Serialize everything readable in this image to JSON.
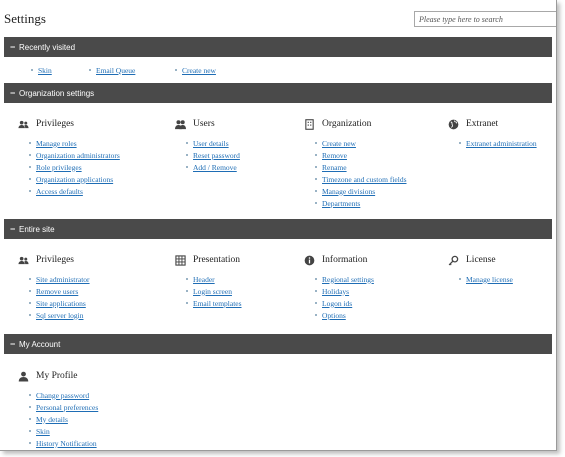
{
  "page": {
    "title": "Settings",
    "search_placeholder": "Please type here to search"
  },
  "sections": {
    "recently_visited": {
      "toggle": "−",
      "title": "Recently visited",
      "links": [
        "Skin",
        "Email Queue",
        "Create new"
      ]
    },
    "organization_settings": {
      "toggle": "−",
      "title": "Organization settings",
      "columns": [
        {
          "title": "Privileges",
          "icon": "users-icon",
          "links": [
            "Manage roles",
            "Organization administrators",
            "Role privileges",
            "Organization applications",
            "Access defaults"
          ]
        },
        {
          "title": "Users",
          "icon": "user-pair-icon",
          "links": [
            "User details",
            "Reset password",
            "Add / Remove"
          ]
        },
        {
          "title": "Organization",
          "icon": "building-icon",
          "links": [
            "Create new",
            "Remove",
            "Rename",
            "Timezone and custom fields",
            "Manage divisions",
            "Departments"
          ]
        },
        {
          "title": "Extranet",
          "icon": "globe-icon",
          "links": [
            "Extranet administration"
          ]
        }
      ]
    },
    "entire_site": {
      "toggle": "−",
      "title": "Entire site",
      "columns": [
        {
          "title": "Privileges",
          "icon": "users-icon",
          "links": [
            "Site administrator",
            "Remove users",
            "Site applications",
            "Sql server login"
          ]
        },
        {
          "title": "Presentation",
          "icon": "grid-icon",
          "links": [
            "Header",
            "Login screen",
            "Email templates"
          ]
        },
        {
          "title": "Information",
          "icon": "info-icon",
          "links": [
            "Regional settings",
            "Holidays",
            "Logon ids",
            "Options"
          ]
        },
        {
          "title": "License",
          "icon": "key-icon",
          "links": [
            "Manage license"
          ]
        }
      ]
    },
    "my_account": {
      "toggle": "−",
      "title": "My Account",
      "columns": [
        {
          "title": "My Profile",
          "icon": "person-icon",
          "links": [
            "Change password",
            "Personal preferences",
            "My details",
            "Skin",
            "History Notification"
          ]
        }
      ]
    }
  },
  "colors": {
    "header_bg": "#4a4a4a",
    "link": "#1e6db5",
    "icon": "#444444"
  }
}
